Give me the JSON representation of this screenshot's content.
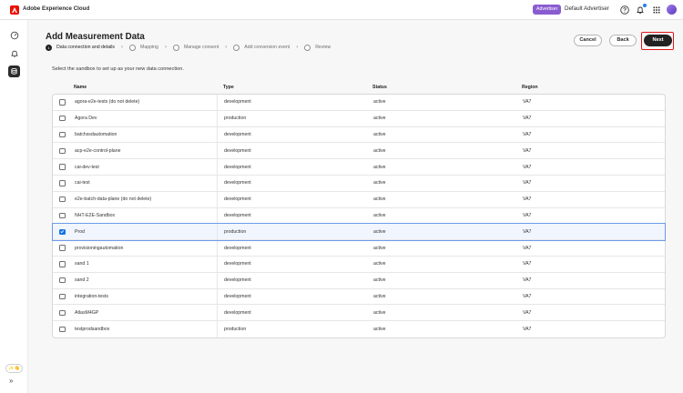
{
  "topbar": {
    "app_title": "Adobe Experience Cloud",
    "badge": "Advertiser",
    "org_name": "Default Advertiser",
    "icons": [
      "help-icon",
      "bell-icon",
      "apps-grid-icon"
    ]
  },
  "rail": {
    "items": [
      "gauge-icon",
      "bell-outline-icon",
      "data-source-icon"
    ],
    "ai_label": "✨👋",
    "expand_label": "»"
  },
  "page": {
    "title": "Add Measurement Data",
    "steps": [
      {
        "label": "Data connection and details",
        "state": "current"
      },
      {
        "label": "Mapping",
        "state": "pending"
      },
      {
        "label": "Manage consent",
        "state": "pending"
      },
      {
        "label": "Add conversion event",
        "state": "pending"
      },
      {
        "label": "Review",
        "state": "pending"
      }
    ],
    "buttons": {
      "cancel": "Cancel",
      "back": "Back",
      "next": "Next"
    },
    "intro": "Select the sandbox to set up as your new data connection."
  },
  "table": {
    "headers": {
      "name": "Name",
      "type": "Type",
      "status": "Status",
      "region": "Region"
    },
    "rows": [
      {
        "name": "agora-e2e-tests (do not delete)",
        "type": "development",
        "status": "active",
        "region": "VA7",
        "checked": false
      },
      {
        "name": "Agora Dev",
        "type": "production",
        "status": "active",
        "region": "VA7",
        "checked": false
      },
      {
        "name": "batchssdautomation",
        "type": "development",
        "status": "active",
        "region": "VA7",
        "checked": false
      },
      {
        "name": "acp-e2e-control-plane",
        "type": "development",
        "status": "active",
        "region": "VA7",
        "checked": false
      },
      {
        "name": "cai-dev-test",
        "type": "development",
        "status": "active",
        "region": "VA7",
        "checked": false
      },
      {
        "name": "cai-test",
        "type": "development",
        "status": "active",
        "region": "VA7",
        "checked": false
      },
      {
        "name": "e2e-batch-data-plane (do not delete)",
        "type": "development",
        "status": "active",
        "region": "VA7",
        "checked": false
      },
      {
        "name": "NHT-E2E-Sandbox",
        "type": "development",
        "status": "active",
        "region": "VA7",
        "checked": false
      },
      {
        "name": "Prod",
        "type": "production",
        "status": "active",
        "region": "VA7",
        "checked": true
      },
      {
        "name": "provisioningautomation",
        "type": "development",
        "status": "active",
        "region": "VA7",
        "checked": false
      },
      {
        "name": "sand 1",
        "type": "development",
        "status": "active",
        "region": "VA7",
        "checked": false
      },
      {
        "name": "sand 2",
        "type": "development",
        "status": "active",
        "region": "VA7",
        "checked": false
      },
      {
        "name": "integration-tests",
        "type": "development",
        "status": "active",
        "region": "VA7",
        "checked": false
      },
      {
        "name": "AtlasM4GP",
        "type": "development",
        "status": "active",
        "region": "VA7",
        "checked": false
      },
      {
        "name": "testprodsandbox",
        "type": "production",
        "status": "active",
        "region": "VA7",
        "checked": false
      }
    ]
  },
  "colors": {
    "brand": "#eb1000",
    "badge": "#8a5cd1",
    "accent": "#1473e6",
    "highlight": "#e0161b"
  }
}
